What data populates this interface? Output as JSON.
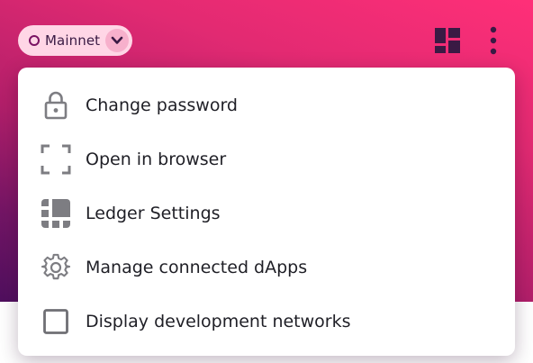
{
  "header": {
    "network": {
      "label": "Mainnet",
      "icon": "network-ring-icon",
      "dropdown_icon": "chevron-down-icon"
    },
    "actions": [
      {
        "icon": "dashboard-grid-icon"
      },
      {
        "icon": "kebab-menu-icon"
      }
    ]
  },
  "menu": {
    "items": [
      {
        "label": "Change password",
        "icon": "lock-icon"
      },
      {
        "label": "Open in browser",
        "icon": "expand-icon"
      },
      {
        "label": "Ledger Settings",
        "icon": "ledger-icon"
      },
      {
        "label": "Manage connected dApps",
        "icon": "gear-icon"
      },
      {
        "label": "Display development networks",
        "icon": "checkbox-icon",
        "checked": false
      }
    ]
  },
  "colors": {
    "header_gradient_top": "#ff2f78",
    "header_gradient_bottom": "#4f0f5e",
    "network_pill_bg": "#ffd6e6",
    "accent_dark": "#3a1a44",
    "menu_icon": "#7d7d82",
    "menu_text": "#1f1f26"
  }
}
